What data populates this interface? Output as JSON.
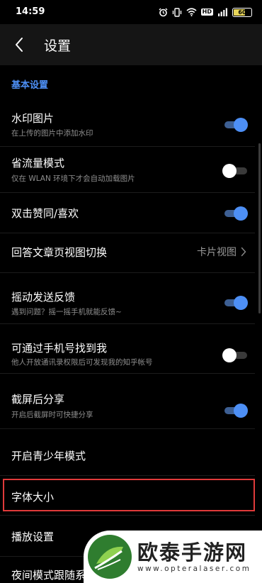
{
  "status": {
    "time": "14:59",
    "hd": "HD",
    "battery": "60"
  },
  "header": {
    "title": "设置"
  },
  "section": {
    "title": "基本设置"
  },
  "settings": [
    {
      "title": "水印图片",
      "subtitle": "在上传的图片中添加水印",
      "toggle": "on"
    },
    {
      "title": "省流量模式",
      "subtitle": "仅在 WLAN 环境下才会自动加载图片",
      "toggle": "off"
    },
    {
      "title": "双击赞同/喜欢",
      "toggle": "on"
    },
    {
      "title": "回答文章页视图切换",
      "value": "卡片视图"
    },
    {
      "title": "摇动发送反馈",
      "subtitle": "遇到问题？摇一摇手机就能反馈~",
      "toggle": "on"
    },
    {
      "title": "可通过手机号找到我",
      "subtitle": "他人开放通讯录权限后可发现我的知乎帐号",
      "toggle": "off"
    },
    {
      "title": "截屏后分享",
      "subtitle": "开启后截屏时可快捷分享",
      "toggle": "on"
    },
    {
      "title": "开启青少年模式"
    },
    {
      "title": "字体大小"
    },
    {
      "title": "播放设置"
    },
    {
      "title": "夜间模式跟随系"
    }
  ],
  "watermark": {
    "brand": "欧泰手游网",
    "url": "www.opteralaser.com"
  },
  "colors": {
    "accent": "#4d8ff5",
    "highlight": "#e03a3a",
    "topbar": "#151515"
  }
}
